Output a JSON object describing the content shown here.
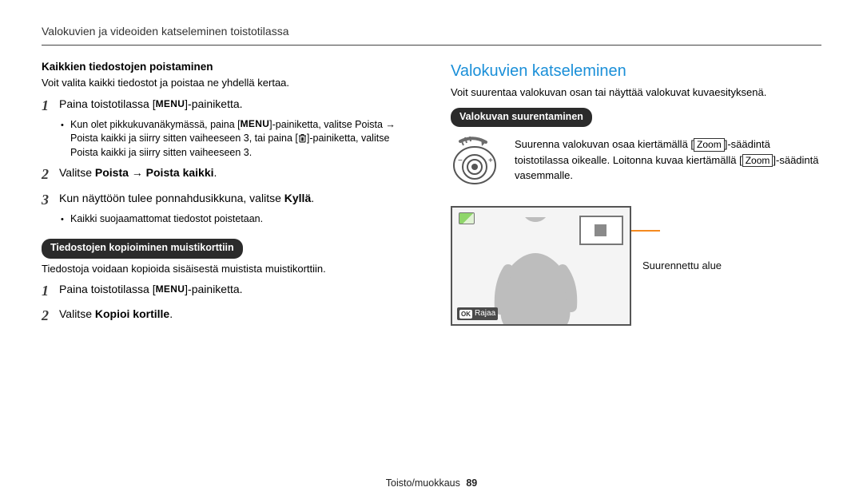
{
  "header": {
    "breadcrumb": "Valokuvien ja videoiden katseleminen toistotilassa"
  },
  "left": {
    "h_delete_all": "Kaikkien tiedostojen poistaminen",
    "delete_all_intro": "Voit valita kaikki tiedostot ja poistaa ne yhdellä kertaa.",
    "menu_glyph": "MENU",
    "step1_pre": "Paina toistotilassa [",
    "step1_post": "]-painiketta.",
    "step1_bullet_a_pre": "Kun olet pikkukuvanäkymässä, paina [",
    "step1_bullet_a_mid": "]-painiketta, valitse ",
    "step1_bullet_a_poista": "Poista",
    "step1_bullet_a_arrow": " → ",
    "step1_bullet_b_pre": "Poista kaikki",
    "step1_bullet_b_mid": " ja siirry sitten vaiheeseen 3, tai paina [",
    "step1_bullet_b_post": "]-painiketta, valitse ",
    "step1_bullet_c_pre": "Poista kaikki",
    "step1_bullet_c_post": " ja siirry sitten vaiheeseen 3.",
    "step2_pre": "Valitse ",
    "step2_bold1": "Poista",
    "step2_arrow": " → ",
    "step2_bold2": "Poista kaikki",
    "step2_post": ".",
    "step3_pre": "Kun näyttöön tulee ponnahdusikkuna, valitse ",
    "step3_bold": "Kyllä",
    "step3_post": ".",
    "step3_bullet": "Kaikki suojaamattomat tiedostot poistetaan.",
    "pill_copy": "Tiedostojen kopioiminen muistikorttiin",
    "copy_intro": "Tiedostoja voidaan kopioida sisäisestä muistista muistikorttiin.",
    "copy_step1_pre": "Paina toistotilassa [",
    "copy_step1_post": "]-painiketta.",
    "copy_step2_pre": "Valitse ",
    "copy_step2_bold": "Kopioi kortille",
    "copy_step2_post": "."
  },
  "right": {
    "h_view": "Valokuvien katseleminen",
    "view_intro": "Voit suurentaa valokuvan osan tai näyttää valokuvat kuvaesityksenä.",
    "pill_enlarge": "Valokuvan suurentaminen",
    "zoom_word": "Zoom",
    "zoom_text_a_pre": "Suurenna valokuvan osaa kiertämällä [",
    "zoom_text_a_post": "]-säädintä toistotilassa oikealle. Loitonna kuvaa kiertämällä [",
    "zoom_text_b_post": "]-säädintä vasemmalle.",
    "callout": "Suurennettu alue",
    "rajaa_ok": "OK",
    "rajaa_label": "Rajaa"
  },
  "footer": {
    "section": "Toisto/muokkaus",
    "page": "89"
  }
}
